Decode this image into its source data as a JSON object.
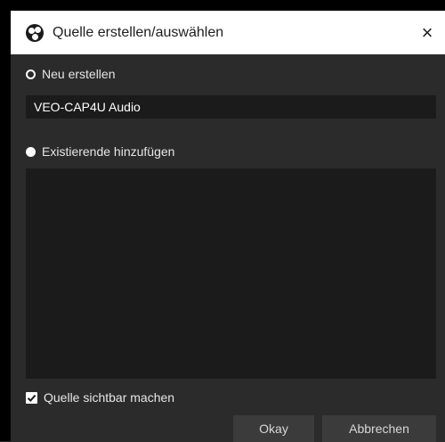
{
  "window": {
    "title": "Quelle erstellen/auswählen",
    "close_icon": "×",
    "app_icon": "obs-logo-icon"
  },
  "create_new": {
    "label": "Neu erstellen",
    "selected": false,
    "name_value": "VEO-CAP4U Audio"
  },
  "add_existing": {
    "label": "Existierende hinzufügen",
    "selected": true,
    "items": []
  },
  "visible_checkbox": {
    "label": "Quelle sichtbar machen",
    "checked": true
  },
  "buttons": {
    "okay": "Okay",
    "cancel": "Abbrechen"
  },
  "colors": {
    "background": "#2b2b2b",
    "field": "#1b1b1b",
    "button": "#3b3b3b",
    "text": "#e6e6e6"
  }
}
